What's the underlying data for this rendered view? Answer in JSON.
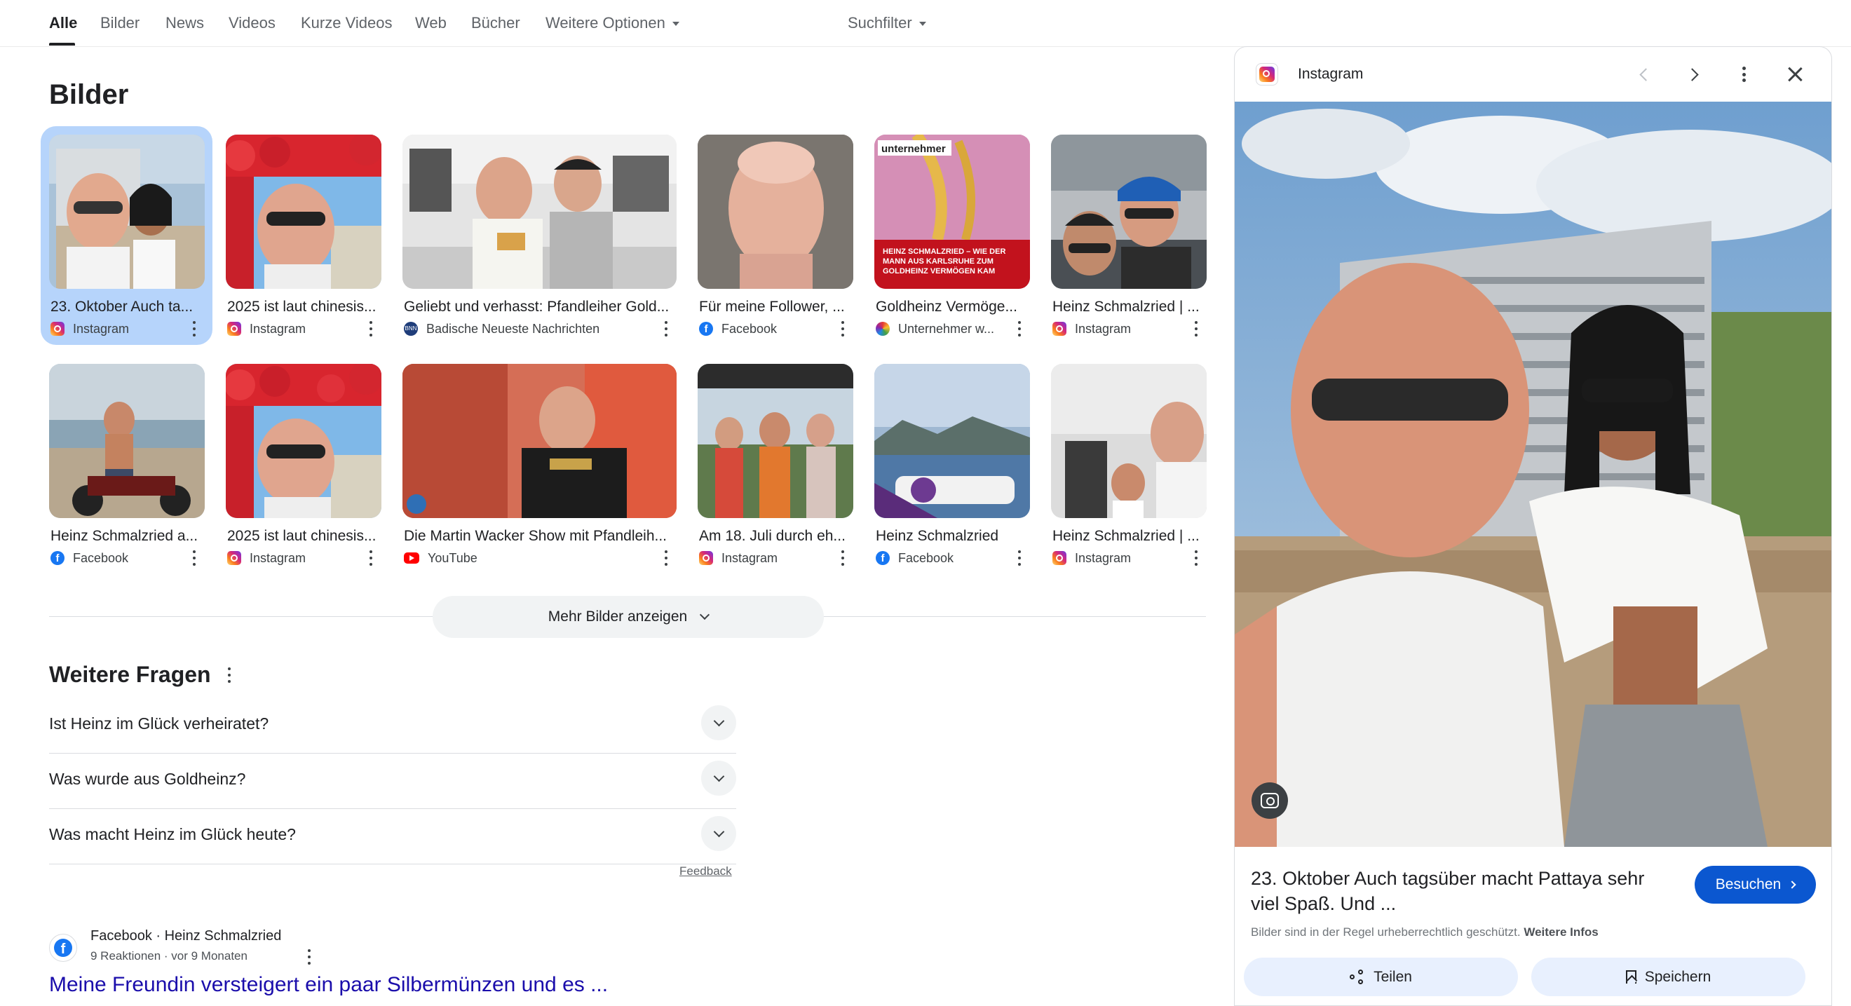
{
  "tabs": [
    {
      "label": "Alle",
      "active": true
    },
    {
      "label": "Bilder"
    },
    {
      "label": "News"
    },
    {
      "label": "Videos"
    },
    {
      "label": "Kurze Videos"
    },
    {
      "label": "Web"
    },
    {
      "label": "Bücher"
    },
    {
      "label": "Weitere Optionen"
    }
  ],
  "filter_label": "Suchfilter",
  "images_heading": "Bilder",
  "images": [
    {
      "title": "23. Oktober Auch ta...",
      "source": "Instagram",
      "icon": "instagram-icon"
    },
    {
      "title": "2025 ist laut chinesis...",
      "source": "Instagram",
      "icon": "instagram-icon"
    },
    {
      "title": "Geliebt und verhasst: Pfandleiher Gold...",
      "source": "Badische Neueste Nachrichten",
      "icon": "bnn-icon"
    },
    {
      "title": "Für meine Follower, ...",
      "source": "Facebook",
      "icon": "facebook-icon"
    },
    {
      "title": "Goldheinz Vermöge...",
      "source": "Unternehmer w...",
      "icon": "unternehmer-icon",
      "thumb_text": "HEINZ SCHMALZRIED – WIE DER MANN AUS KARLSRUHE ZUM GOLDHEINZ VERMÖGEN KAM",
      "thumb_brand": "unternehmer"
    },
    {
      "title": "Heinz Schmalzried | ...",
      "source": "Instagram",
      "icon": "instagram-icon"
    },
    {
      "title": "Heinz Schmalzried a...",
      "source": "Facebook",
      "icon": "facebook-icon"
    },
    {
      "title": "2025 ist laut chinesis...",
      "source": "Instagram",
      "icon": "instagram-icon"
    },
    {
      "title": "Die Martin Wacker Show mit Pfandleih...",
      "source": "YouTube",
      "icon": "youtube-icon"
    },
    {
      "title": "Am 18. Juli durch eh...",
      "source": "Instagram",
      "icon": "instagram-icon"
    },
    {
      "title": "Heinz Schmalzried",
      "source": "Facebook",
      "icon": "facebook-icon"
    },
    {
      "title": "Heinz Schmalzried | ...",
      "source": "Instagram",
      "icon": "instagram-icon"
    }
  ],
  "more_images_label": "Mehr Bilder anzeigen",
  "questions_heading": "Weitere Fragen",
  "questions": [
    "Ist Heinz im Glück verheiratet?",
    "Was wurde aus Goldheinz?",
    "Was macht Heinz im Glück heute?"
  ],
  "feedback_label": "Feedback",
  "result": {
    "site": "Facebook · Heinz Schmalzried",
    "meta": "9 Reaktionen · vor 9 Monaten",
    "title": "Meine Freundin versteigert ein paar Silbermünzen und es ..."
  },
  "panel": {
    "source": "Instagram",
    "caption": "23. Oktober Auch tagsüber macht Pattaya sehr viel Spaß. Und ...",
    "visit_label": "Besuchen",
    "copyright": "Bilder sind in der Regel urheberrechtlich geschützt.",
    "copyright_link": "Weitere Infos",
    "share_label": "Teilen",
    "save_label": "Speichern"
  },
  "colors": {
    "accent_blue": "#0b57d0",
    "selected_bg": "#b6d4fb",
    "link": "#1a0dab"
  }
}
